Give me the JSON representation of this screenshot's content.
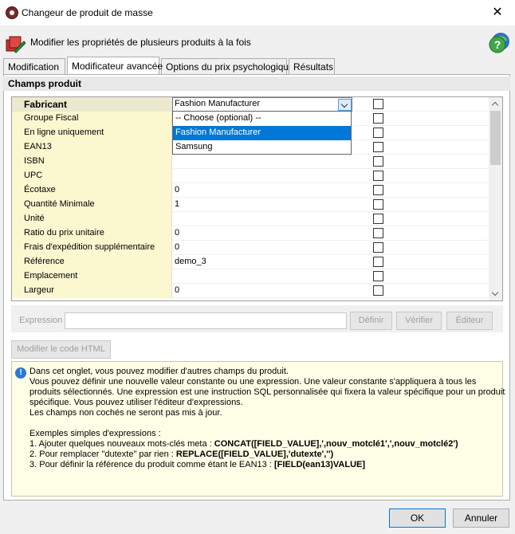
{
  "window": {
    "title": "Changeur de produit de masse",
    "close_label": "✕"
  },
  "banner": {
    "text": "Modifier les propriétés de plusieurs produits à la fois"
  },
  "tabs": [
    {
      "label": "Modification",
      "active": false
    },
    {
      "label": "Modificateur avancée",
      "active": true
    },
    {
      "label": "Options du prix psychologique",
      "active": false
    },
    {
      "label": "Résultats",
      "active": false
    }
  ],
  "section": {
    "title": "Champs produit"
  },
  "grid": {
    "rows": [
      {
        "label": "Fabricant",
        "value": "Fashion Manufacturer",
        "bold": true,
        "checked": false
      },
      {
        "label": "Groupe Fiscal",
        "value": "",
        "checked": false
      },
      {
        "label": "En ligne uniquement",
        "value": "",
        "checked": false
      },
      {
        "label": "EAN13",
        "value": "",
        "checked": false
      },
      {
        "label": "ISBN",
        "value": "",
        "checked": false
      },
      {
        "label": "UPC",
        "value": "",
        "checked": false
      },
      {
        "label": "Écotaxe",
        "value": "0",
        "checked": false
      },
      {
        "label": "Quantité Minimale",
        "value": "1",
        "checked": false
      },
      {
        "label": "Unité",
        "value": "",
        "checked": false
      },
      {
        "label": "Ratio du prix unitaire",
        "value": "0",
        "checked": false
      },
      {
        "label": "Frais d'expédition supplémentaire",
        "value": "0",
        "checked": false
      },
      {
        "label": "Référence",
        "value": "demo_3",
        "checked": false
      },
      {
        "label": "Emplacement",
        "value": "",
        "checked": false
      },
      {
        "label": "Largeur",
        "value": "0",
        "checked": false
      }
    ],
    "dropdown": {
      "options": [
        "-- Choose (optional) --",
        "Fashion Manufacturer",
        "Samsung"
      ],
      "selected_index": 1
    }
  },
  "expression": {
    "label": "Expression",
    "value": "",
    "define_label": "Définir",
    "verify_label": "Vérifier",
    "editor_label": "Éditeur",
    "html_label": "Modifier le code HTML"
  },
  "info": {
    "icon": "info-icon",
    "lines": [
      "Dans cet onglet, vous pouvez modifier d'autres champs du produit.",
      "Vous pouvez définir une nouvelle valeur constante ou une expression. Une valeur constante s'appliquera à tous les",
      "produits sélectionnés. Une expression est une instruction SQL personnalisée qui fixera la valeur spécifique pour un produit",
      "spécifique. Vous pouvez utiliser l'éditeur d'expressions.",
      "Les champs non cochés ne seront pas mis à jour.",
      "",
      "Exemples simples d'expressions :"
    ],
    "examples": [
      {
        "text": " 1. Ajouter quelques nouveaux mots-clés meta : ",
        "code": "CONCAT([FIELD_VALUE],',nouv_motclé1',',nouv_motclé2')"
      },
      {
        "text": " 2. Pour remplacer \"dutexte\" par rien : ",
        "code": "REPLACE([FIELD_VALUE],'dutexte','')"
      },
      {
        "text": " 3. Pour définir la référence du produit comme étant le EAN13 : ",
        "code": "[FIELD(ean13)VALUE]"
      }
    ]
  },
  "footer": {
    "ok_label": "OK",
    "cancel_label": "Annuler"
  }
}
